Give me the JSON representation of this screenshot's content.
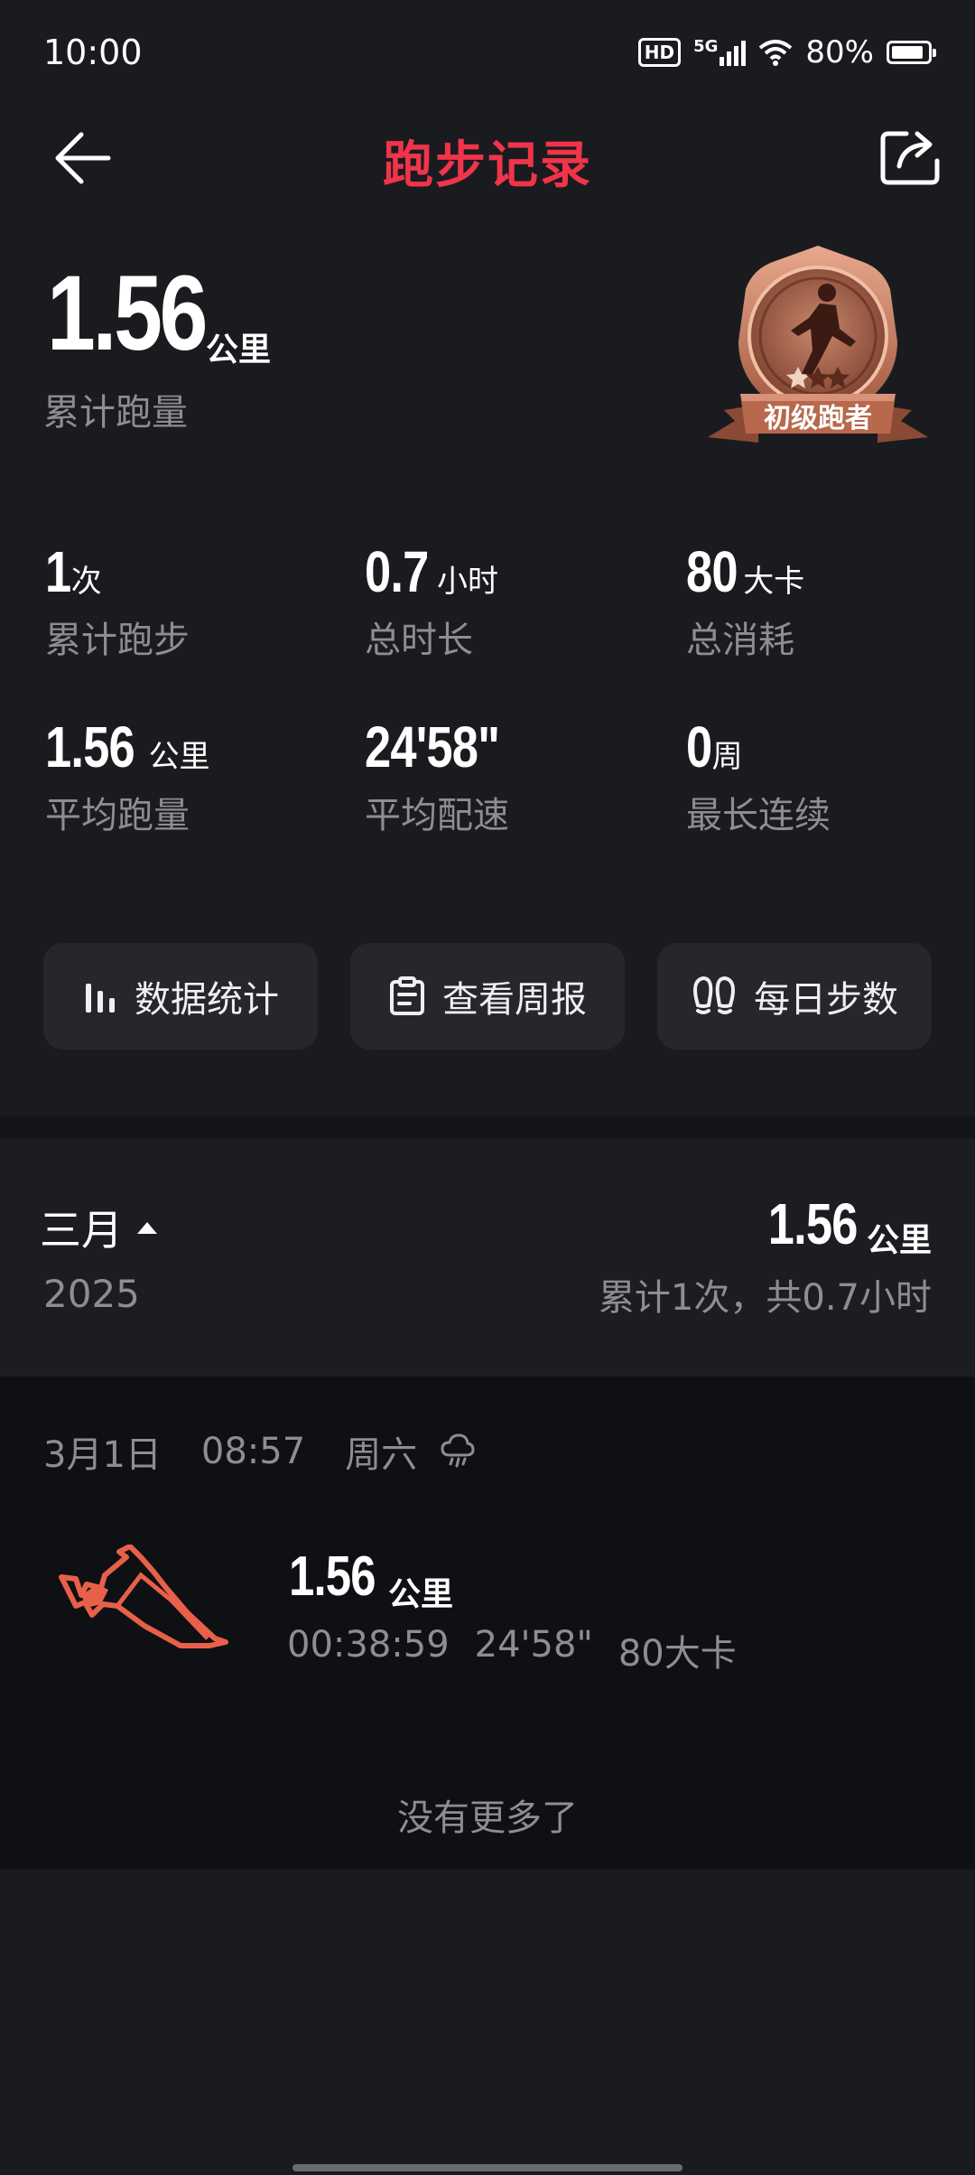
{
  "status_bar": {
    "time": "10:00",
    "hd": "HD",
    "network": "5G",
    "battery": "80%"
  },
  "header": {
    "title": "跑步记录",
    "back_icon": "arrow-left-icon",
    "share_icon": "share-icon"
  },
  "summary": {
    "total_distance": "1.56",
    "total_distance_unit": "公里",
    "total_distance_label": "累计跑量",
    "medal_label": "初级跑者",
    "medal_stars": 3
  },
  "stats": [
    {
      "value": "1",
      "unit": "次",
      "label": "累计跑步"
    },
    {
      "value": "0.7",
      "unit": "小时",
      "label": "总时长"
    },
    {
      "value": "80",
      "unit": "大卡",
      "label": "总消耗"
    },
    {
      "value": "1.56",
      "unit": "公里",
      "label": "平均跑量"
    },
    {
      "value": "24'58\"",
      "unit": "",
      "label": "平均配速"
    },
    {
      "value": "0",
      "unit": "周",
      "label": "最长连续"
    }
  ],
  "actions": [
    {
      "label": "数据统计",
      "icon": "bar-chart-icon"
    },
    {
      "label": "查看周报",
      "icon": "clipboard-icon"
    },
    {
      "label": "每日步数",
      "icon": "footprints-icon"
    }
  ],
  "month": {
    "name": "三月",
    "year": "2025",
    "distance": "1.56",
    "distance_unit": "公里",
    "summary": "累计1次，共0.7小时"
  },
  "records": [
    {
      "date": "3月1日",
      "time": "08:57",
      "weekday": "周六",
      "weather_icon": "cloud-rain-icon",
      "distance": "1.56",
      "distance_unit": "公里",
      "duration": "00:38:59",
      "pace": "24'58\"",
      "calories": "80大卡"
    }
  ],
  "footer_text": "没有更多了",
  "colors": {
    "accent": "#f0344a",
    "route": "#e8604a",
    "background": "#1a1b1f"
  }
}
